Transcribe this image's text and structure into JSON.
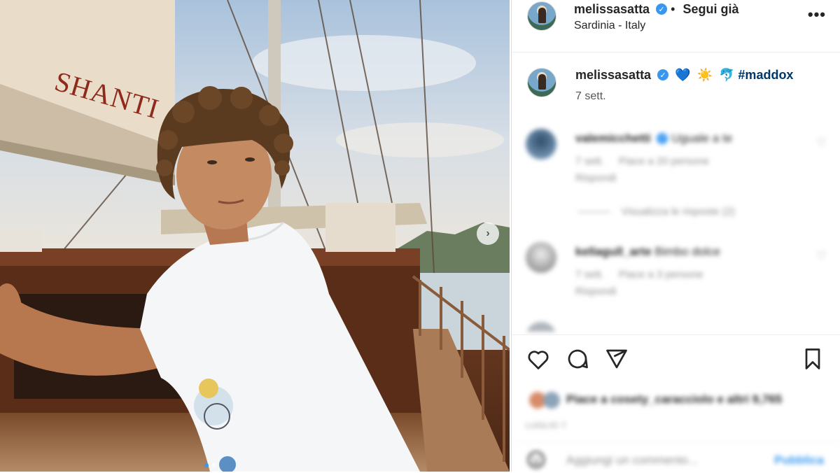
{
  "post": {
    "username": "melissasatta",
    "follow_label": "Segui già",
    "location": "Sardinia - Italy",
    "more_icon": "more-horizontal-icon"
  },
  "caption": {
    "username": "melissasatta",
    "emojis": [
      "💙",
      "☀️",
      "🐬"
    ],
    "hashtag": "#maddox",
    "time": "7 sett."
  },
  "photo": {
    "sail_text": "SHANTI",
    "next_icon": "chevron-right-icon"
  },
  "comments": [
    {
      "username": "valemicchetti",
      "text": "Uguale a te",
      "time": "7 sett.",
      "likes": "Piace a 20 persone",
      "reply": "Rispondi",
      "view_replies": "Visualizza le risposte (2)"
    },
    {
      "username": "kellagull_arte",
      "text": "Bimbo dolce",
      "time": "7 sett.",
      "likes": "Piace a 3 persone",
      "reply": "Rispondi"
    }
  ],
  "actions": {
    "likes_text": "Piace a cosety_caracciolo e altri 9,765",
    "date": "LUGLIO 7",
    "add_comment_placeholder": "Aggiungi un commento...",
    "publish_label": "Pubblica"
  },
  "colors": {
    "link_blue": "#3897f0",
    "hashtag_blue": "#00376b",
    "sail_red": "#8e2a1c"
  }
}
